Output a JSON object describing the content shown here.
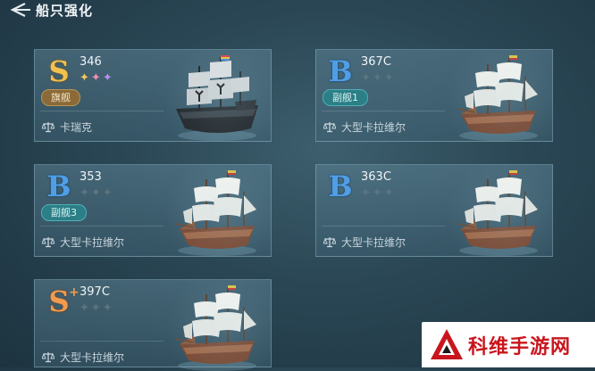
{
  "header": {
    "title": "船只强化"
  },
  "cards": [
    {
      "grade": "S",
      "power": "346",
      "badge": "旗舰",
      "name": "卡瑞克"
    },
    {
      "grade": "B",
      "power": "367C",
      "badge": "副舰1",
      "name": "大型卡拉维尔"
    },
    {
      "grade": "B",
      "power": "353",
      "badge": "副舰3",
      "name": "大型卡拉维尔"
    },
    {
      "grade": "B",
      "power": "363C",
      "badge": "",
      "name": "大型卡拉维尔"
    },
    {
      "grade": "S",
      "grade_plus": "+",
      "power": "397C",
      "badge": "",
      "name": "大型卡拉维尔"
    }
  ],
  "stars_glyph": "✦✦✦",
  "watermark": {
    "text": "科维手游网"
  },
  "colors": {
    "grade_s": "#f2c04e",
    "grade_b": "#4f9ee6",
    "grade_s_plus": "#f29a4e",
    "badge_flagship": "#8a6a38",
    "badge_vice": "#2c7f86",
    "watermark_red": "#c8161d"
  },
  "icons": [
    "back-arrow-icon",
    "balance-scale-icon",
    "flagship-ship-icon",
    "caravel-ship-icon",
    "watermark-logo-icon"
  ]
}
